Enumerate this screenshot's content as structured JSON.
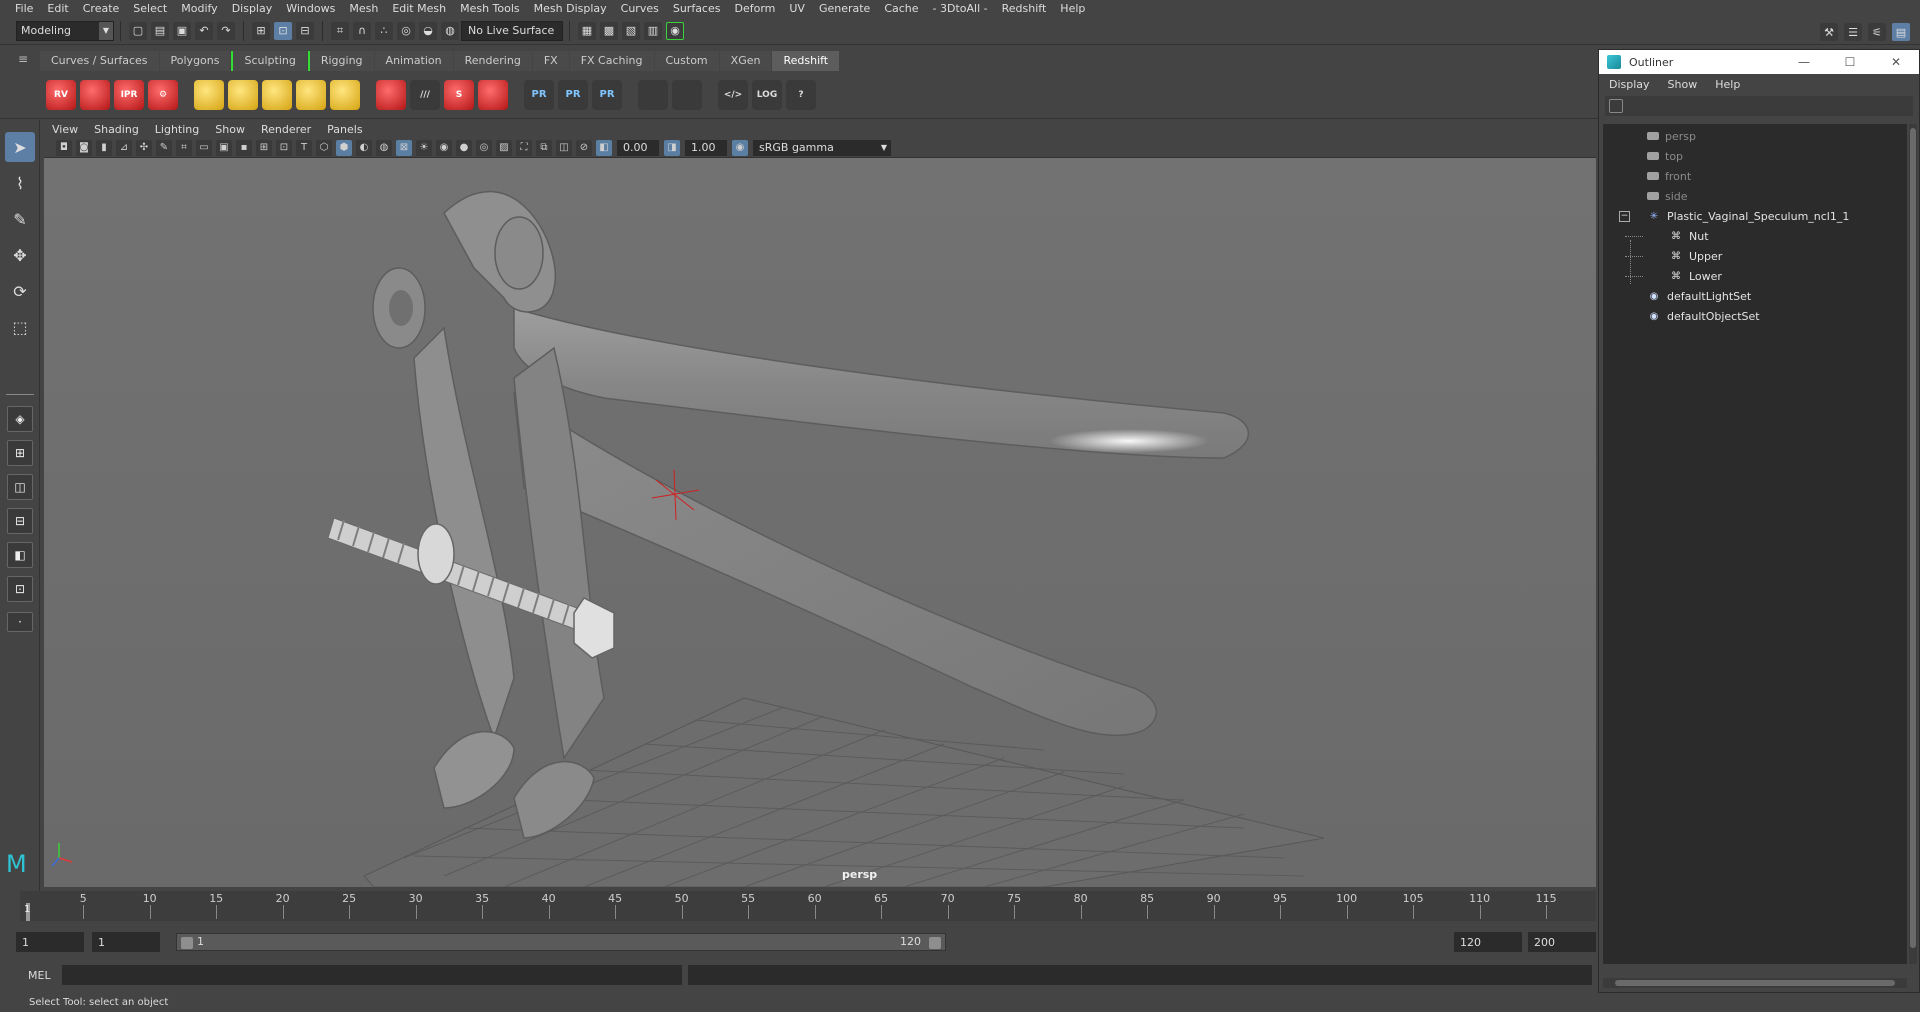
{
  "menubar": [
    "File",
    "Edit",
    "Create",
    "Select",
    "Modify",
    "Display",
    "Windows",
    "Mesh",
    "Edit Mesh",
    "Mesh Tools",
    "Mesh Display",
    "Curves",
    "Surfaces",
    "Deform",
    "UV",
    "Generate",
    "Cache",
    "- 3DtoAll -",
    "Redshift",
    "Help"
  ],
  "statusline": {
    "mode": "Modeling",
    "live_surface": "No Live Surface"
  },
  "shelf": {
    "tabs": [
      "Curves / Surfaces",
      "Polygons",
      "Sculpting",
      "Rigging",
      "Animation",
      "Rendering",
      "FX",
      "FX Caching",
      "Custom",
      "XGen",
      "Redshift"
    ],
    "active_tab": "Redshift",
    "buttons": [
      {
        "name": "rv-render-icon",
        "label": "RV"
      },
      {
        "name": "render-icon",
        "label": ""
      },
      {
        "name": "ipr-render-icon",
        "label": "IPR"
      },
      {
        "name": "render-settings-icon",
        "label": "⚙"
      },
      {
        "name": "proxy-icon",
        "label": ""
      },
      {
        "name": "grid-light-icon",
        "label": ""
      },
      {
        "name": "cone-light-icon",
        "label": ""
      },
      {
        "name": "dome-light-icon",
        "label": ""
      },
      {
        "name": "sun-light-icon",
        "label": ""
      },
      {
        "name": "material-cube-icon",
        "label": ""
      },
      {
        "name": "hair-icon",
        "label": "///"
      },
      {
        "name": "rope-icon",
        "label": "S"
      },
      {
        "name": "sphere-icon",
        "label": ""
      },
      {
        "name": "pr-export-icon",
        "label": "PR"
      },
      {
        "name": "pr-import-icon",
        "label": "PR"
      },
      {
        "name": "pr-swap-icon",
        "label": "PR"
      },
      {
        "name": "bowl-icon",
        "label": ""
      },
      {
        "name": "bowl2-icon",
        "label": ""
      },
      {
        "name": "script-icon",
        "label": "</>"
      },
      {
        "name": "log-icon",
        "label": "LOG"
      },
      {
        "name": "help-icon",
        "label": "?"
      }
    ]
  },
  "viewport": {
    "menu": [
      "View",
      "Shading",
      "Lighting",
      "Show",
      "Renderer",
      "Panels"
    ],
    "exposure": "0.00",
    "gamma": "1.00",
    "color_space": "sRGB gamma",
    "camera_label": "persp"
  },
  "timeline": {
    "ticks": [
      "5",
      "10",
      "15",
      "20",
      "25",
      "30",
      "35",
      "40",
      "45",
      "50",
      "55",
      "60",
      "65",
      "70",
      "75",
      "80",
      "85",
      "90",
      "95",
      "100",
      "105",
      "110",
      "115"
    ],
    "current_frame": "1"
  },
  "range": {
    "start": "1",
    "playback_start": "1",
    "slider_start": "1",
    "slider_end": "120",
    "playback_end": "120",
    "end": "200"
  },
  "cmdline": {
    "label": "MEL"
  },
  "helpline": "Select Tool: select an object",
  "outliner": {
    "title": "Outliner",
    "menu": [
      "Display",
      "Show",
      "Help"
    ],
    "items": [
      {
        "label": "persp",
        "type": "camera",
        "indent": 0
      },
      {
        "label": "top",
        "type": "camera",
        "indent": 0
      },
      {
        "label": "front",
        "type": "camera",
        "indent": 0
      },
      {
        "label": "side",
        "type": "camera",
        "indent": 0
      },
      {
        "label": "Plastic_Vaginal_Speculum_ncl1_1",
        "type": "group",
        "indent": 0
      },
      {
        "label": "Nut",
        "type": "mesh",
        "indent": 1
      },
      {
        "label": "Upper",
        "type": "mesh",
        "indent": 1
      },
      {
        "label": "Lower",
        "type": "mesh",
        "indent": 1
      },
      {
        "label": "defaultLightSet",
        "type": "set",
        "indent": 0
      },
      {
        "label": "defaultObjectSet",
        "type": "set",
        "indent": 0
      }
    ]
  },
  "colors": {
    "accent": "#5d7fa6",
    "bracket_green": "#33dd33",
    "redshift_red": "#d42a2a"
  }
}
